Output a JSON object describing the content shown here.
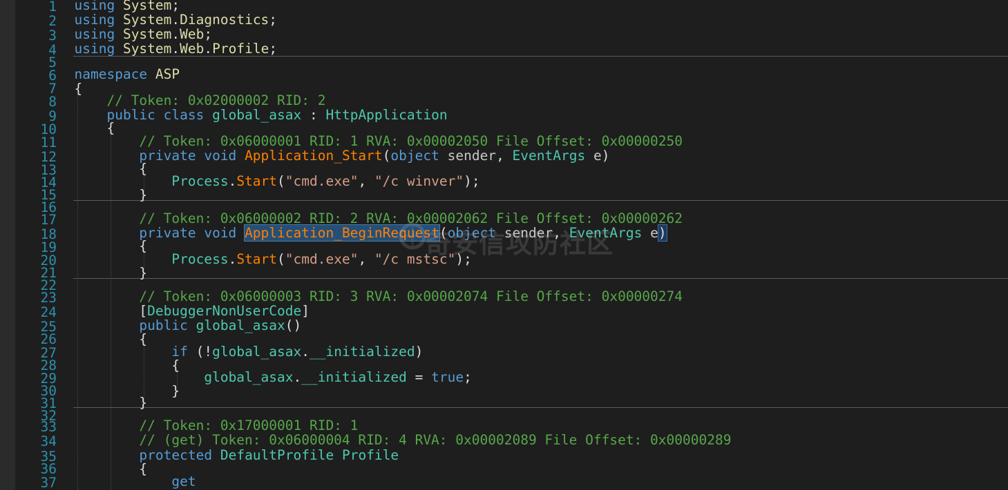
{
  "editor": {
    "line_numbers": [
      "1",
      "2",
      "3",
      "4",
      "5",
      "6",
      "7",
      "8",
      "9",
      "10",
      "11",
      "12",
      "13",
      "14",
      "15",
      "16",
      "17",
      "18",
      "19",
      "20",
      "21",
      "22",
      "23",
      "24",
      "25",
      "26",
      "27",
      "28",
      "29",
      "30",
      "31",
      "32",
      "33",
      "34",
      "35",
      "36",
      "37"
    ],
    "code": {
      "l1_kw": "using",
      "l1_ns": "System",
      "l2_kw": "using",
      "l2_ns1": "System",
      "l2_ns2": "Diagnostics",
      "l3_kw": "using",
      "l3_ns1": "System",
      "l3_ns2": "Web",
      "l4_kw": "using",
      "l4_ns1": "System",
      "l4_ns2": "Web",
      "l4_ns3": "Profile",
      "l6_kw": "namespace",
      "l6_ns": "ASP",
      "l7": "{",
      "l8": "// Token: 0x02000002 RID: 2",
      "l9_kw": "public class",
      "l9_ty": "global_asax",
      "l9_sep": " : ",
      "l9_base": "HttpApplication",
      "l10": "{",
      "l11": "// Token: 0x06000001 RID: 1 RVA: 0x00002050 File Offset: 0x00000250",
      "l12_kw": "private void",
      "l12_mt": "Application_Start",
      "l12_kw2": "object",
      "l12_p1": "sender",
      "l12_ty": "EventArgs",
      "l12_p2": "e",
      "l13": "{",
      "l14_ty": "Process",
      "l14_mt": "Start",
      "l14_s1": "\"cmd.exe\"",
      "l14_s2": "\"/c winver\"",
      "l15": "}",
      "l17": "// Token: 0x06000002 RID: 2 RVA: 0x00002062 File Offset: 0x00000262",
      "l18_kw": "private void",
      "l18_mt": "Application_BeginRequest",
      "l18_kw2": "object",
      "l18_p1": "sender",
      "l18_ty": "EventArgs",
      "l18_p2": "e",
      "l19": "{",
      "l20_ty": "Process",
      "l20_mt": "Start",
      "l20_s1": "\"cmd.exe\"",
      "l20_s2": "\"/c mstsc\"",
      "l21": "}",
      "l23": "// Token: 0x06000003 RID: 3 RVA: 0x00002074 File Offset: 0x00000274",
      "l24_ty": "DebuggerNonUserCode",
      "l25_kw": "public",
      "l25_ty": "global_asax",
      "l26": "{",
      "l27_kw": "if",
      "l27_ty": "global_asax",
      "l27_fd": "__initialized",
      "l28": "{",
      "l29_ty": "global_asax",
      "l29_fd": "__initialized",
      "l29_kw": "true",
      "l30": "}",
      "l31": "}",
      "l33": "// Token: 0x17000001 RID: 1",
      "l34": "// (get) Token: 0x06000004 RID: 4 RVA: 0x00002089 File Offset: 0x00000289",
      "l35_kw": "protected",
      "l35_ty": "DefaultProfile",
      "l35_id": "Profile",
      "l36": "{",
      "l37_kw": "get"
    }
  },
  "watermark": {
    "text": "奇安信攻防社区"
  },
  "colors": {
    "background": "#1e1e1e",
    "line_number": "#2b91af",
    "keyword": "#569cd6",
    "type": "#4ec9b0",
    "namespace": "#dcdcaa",
    "method": "#ff8000",
    "string": "#d69d85",
    "comment": "#57a64a",
    "highlight": "#264f78"
  }
}
